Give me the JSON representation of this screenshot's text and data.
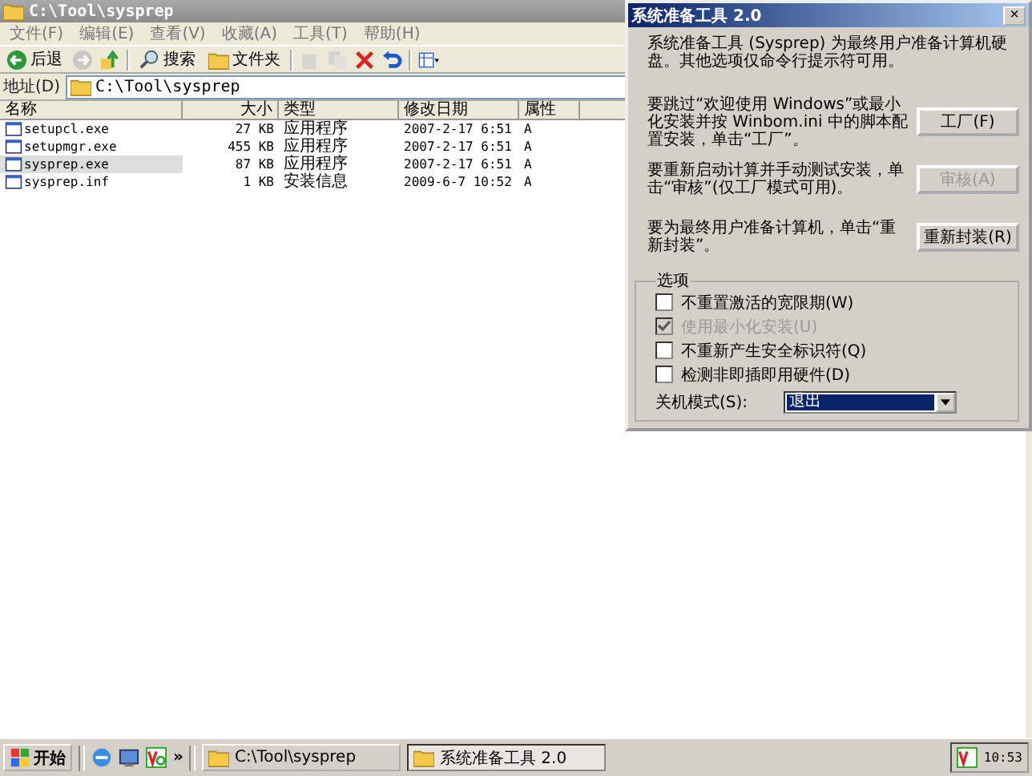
{
  "explorer": {
    "title": "C:\\Tool\\sysprep",
    "menu": [
      "文件(F)",
      "编辑(E)",
      "查看(V)",
      "收藏(A)",
      "工具(T)",
      "帮助(H)"
    ],
    "toolbar": {
      "back": "后退",
      "search": "搜索",
      "folders": "文件夹"
    },
    "address": {
      "label": "地址(D)",
      "value": "C:\\Tool\\sysprep"
    },
    "columns": [
      "名称",
      "大小",
      "类型",
      "修改日期",
      "属性"
    ],
    "rows": [
      {
        "name": "setupcl.exe",
        "size": "27 KB",
        "type": "应用程序",
        "modified": "2007-2-17 6:51",
        "attr": "A",
        "selected": false
      },
      {
        "name": "setupmgr.exe",
        "size": "455 KB",
        "type": "应用程序",
        "modified": "2007-2-17 6:51",
        "attr": "A",
        "selected": false
      },
      {
        "name": "sysprep.exe",
        "size": "87 KB",
        "type": "应用程序",
        "modified": "2007-2-17 6:51",
        "attr": "A",
        "selected": true
      },
      {
        "name": "sysprep.inf",
        "size": "1 KB",
        "type": "安装信息",
        "modified": "2009-6-7 10:52",
        "attr": "A",
        "selected": false
      }
    ]
  },
  "dialog": {
    "title": "系统准备工具 2.0",
    "close": "×",
    "intro": "系统准备工具 (Sysprep) 为最终用户准备计算机硬盘。其他选项仅命令行提示符可用。",
    "actions": [
      {
        "text": "要跳过“欢迎使用 Windows”或最小化安装并按 Winbom.ini 中的脚本配置安装，单击“工厂”。",
        "button": "工厂(F)",
        "disabled": false
      },
      {
        "text": "要重新启动计算并手动测试安装，单击“审核”(仅工厂模式可用)。",
        "button": "审核(A)",
        "disabled": true
      },
      {
        "text": "要为最终用户准备计算机，单击“重新封装”。",
        "button": "重新封装(R)",
        "disabled": false
      }
    ],
    "options": {
      "title": "选项",
      "checks": [
        {
          "label": "不重置激活的宽限期(W)",
          "checked": false,
          "disabled": false
        },
        {
          "label": "使用最小化安装(U)",
          "checked": true,
          "disabled": true
        },
        {
          "label": "不重新产生安全标识符(Q)",
          "checked": false,
          "disabled": false
        },
        {
          "label": "检测非即插即用硬件(D)",
          "checked": false,
          "disabled": false
        }
      ],
      "shutdown": {
        "label": "关机模式(S):",
        "value": "退出"
      }
    }
  },
  "taskbar": {
    "start": "开始",
    "more": "»",
    "tasks": [
      {
        "label": "C:\\Tool\\sysprep",
        "selected": false
      },
      {
        "label": "系统准备工具 2.0",
        "selected": true
      }
    ],
    "clock": "10:53"
  }
}
